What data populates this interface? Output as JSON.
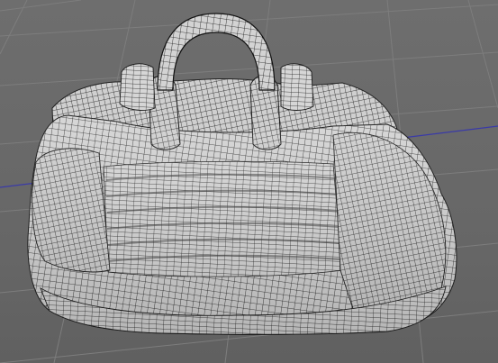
{
  "viewport": {
    "colors": {
      "background": "#6b6b6b",
      "grid_line": "#7d7d7d",
      "axis_x": "#3a3aa8",
      "mesh_fill": "#d2d2d2",
      "wireframe": "#1a1a1a"
    },
    "scene": {
      "object": "wireframe-bag-mesh",
      "show_grid": true,
      "show_axis": true
    }
  }
}
